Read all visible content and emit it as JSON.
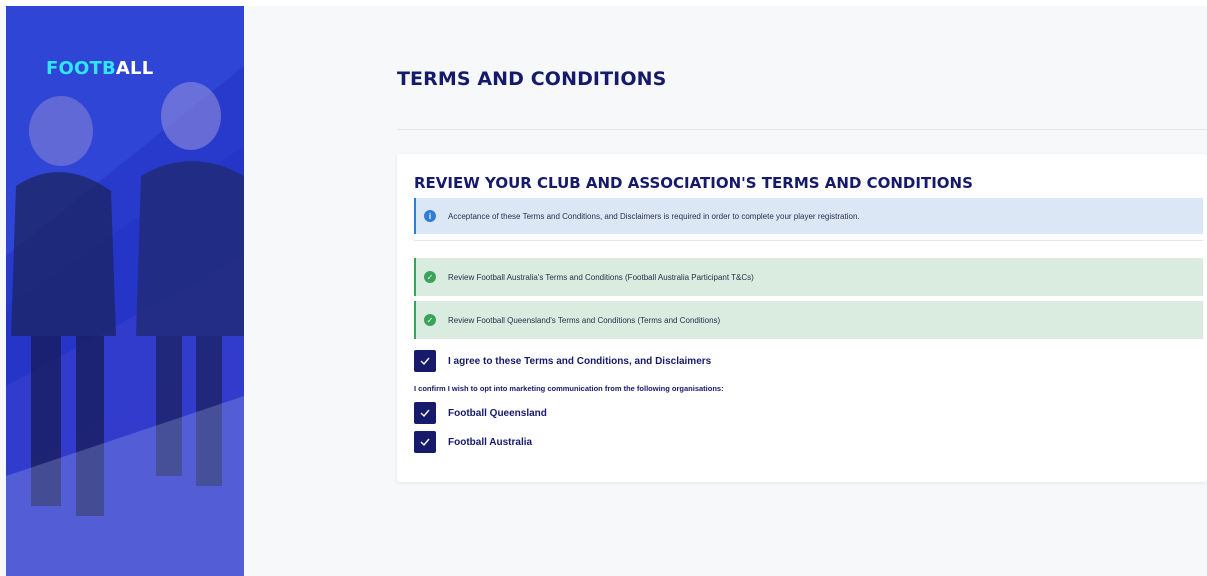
{
  "brand": {
    "logo_part1": "FOOTB",
    "logo_part2": "ALL",
    "colors": {
      "primary": "#151a6b",
      "accent": "#2ee6ff",
      "sidebar": "#2430c2"
    }
  },
  "page": {
    "title": "TERMS AND CONDITIONS"
  },
  "card": {
    "title": "REVIEW YOUR CLUB AND ASSOCIATION'S TERMS AND CONDITIONS",
    "info_alert": {
      "icon": "info-icon",
      "text": "Acceptance of these Terms and Conditions, and Disclaimers is required in order to complete your player registration."
    },
    "review_items": [
      {
        "icon": "check-circle-icon",
        "text": "Review Football Australia's Terms and Conditions (Football Australia Participant T&Cs)"
      },
      {
        "icon": "check-circle-icon",
        "text": "Review Football Queensland's Terms and Conditions (Terms and Conditions)"
      }
    ],
    "agree_checkbox": {
      "label": "I agree to these Terms and Conditions, and Disclaimers",
      "checked": true
    },
    "optin_text": "I confirm I wish to opt into marketing communication from the following organisations:",
    "optin_checkboxes": [
      {
        "label": "Football Queensland",
        "checked": true
      },
      {
        "label": "Football Australia",
        "checked": true
      }
    ]
  }
}
